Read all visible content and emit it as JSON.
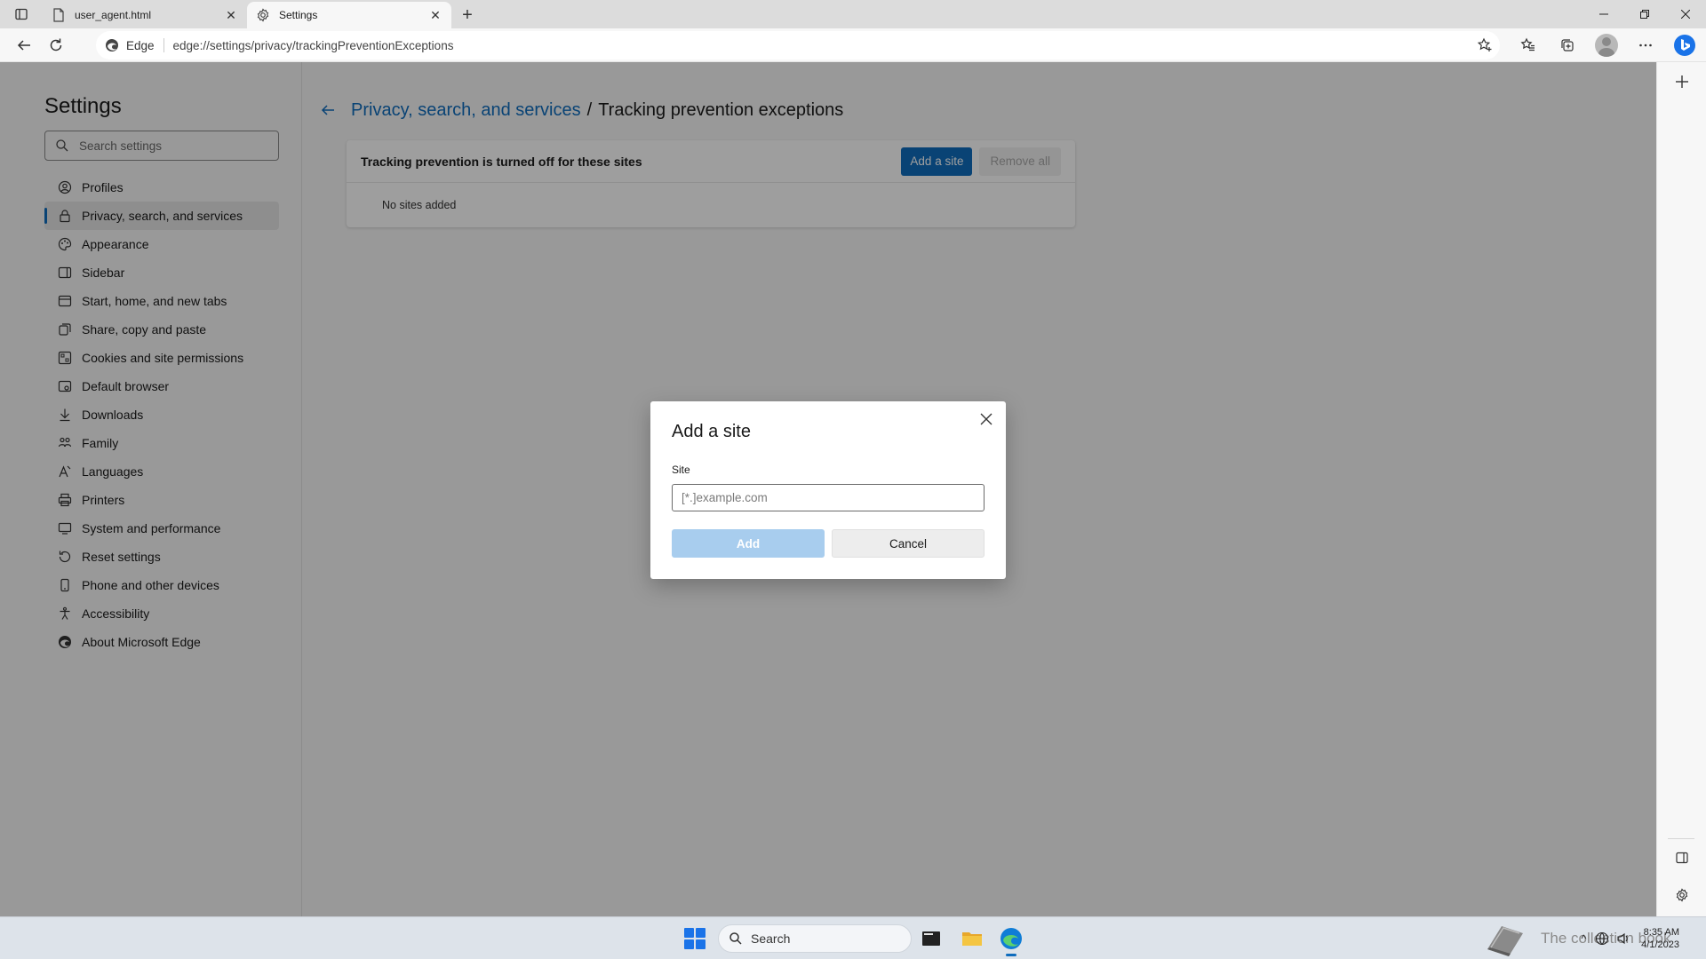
{
  "browser": {
    "tabs": [
      {
        "title": "user_agent.html",
        "icon": "file-icon",
        "active": false
      },
      {
        "title": "Settings",
        "icon": "gear-icon",
        "active": true
      }
    ],
    "address_prefix": "Edge",
    "url": "edge://settings/privacy/trackingPreventionExceptions"
  },
  "settings": {
    "title": "Settings",
    "search_placeholder": "Search settings",
    "nav": [
      {
        "label": "Profiles",
        "icon": "profile-icon"
      },
      {
        "label": "Privacy, search, and services",
        "icon": "lock-icon",
        "selected": true
      },
      {
        "label": "Appearance",
        "icon": "appearance-icon"
      },
      {
        "label": "Sidebar",
        "icon": "sidebar-icon"
      },
      {
        "label": "Start, home, and new tabs",
        "icon": "home-icon"
      },
      {
        "label": "Share, copy and paste",
        "icon": "share-icon"
      },
      {
        "label": "Cookies and site permissions",
        "icon": "cookies-icon"
      },
      {
        "label": "Default browser",
        "icon": "browser-icon"
      },
      {
        "label": "Downloads",
        "icon": "download-icon"
      },
      {
        "label": "Family",
        "icon": "family-icon"
      },
      {
        "label": "Languages",
        "icon": "languages-icon"
      },
      {
        "label": "Printers",
        "icon": "printer-icon"
      },
      {
        "label": "System and performance",
        "icon": "system-icon"
      },
      {
        "label": "Reset settings",
        "icon": "reset-icon"
      },
      {
        "label": "Phone and other devices",
        "icon": "phone-icon"
      },
      {
        "label": "Accessibility",
        "icon": "accessibility-icon"
      },
      {
        "label": "About Microsoft Edge",
        "icon": "edge-icon"
      }
    ]
  },
  "page": {
    "breadcrumb_parent": "Privacy, search, and services",
    "breadcrumb_separator": "/",
    "breadcrumb_current": "Tracking prevention exceptions",
    "card_label": "Tracking prevention is turned off for these sites",
    "add_site_label": "Add a site",
    "remove_all_label": "Remove all",
    "empty_text": "No sites added"
  },
  "dialog": {
    "title": "Add a site",
    "field_label": "Site",
    "field_placeholder": "[*.]example.com",
    "field_value": "",
    "add_label": "Add",
    "cancel_label": "Cancel"
  },
  "taskbar": {
    "search_label": "Search",
    "watermark": "The collection book",
    "time": "8:35 AM",
    "date": "4/1/2023"
  },
  "colors": {
    "accent": "#0f6cbd",
    "add_disabled": "#a8cdee"
  }
}
